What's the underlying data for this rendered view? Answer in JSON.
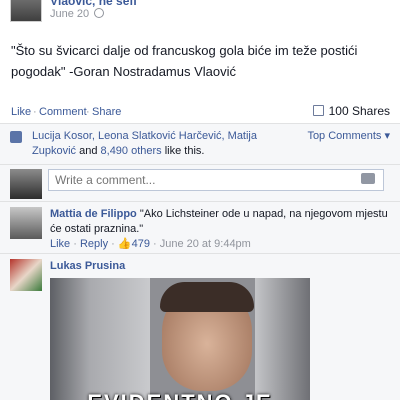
{
  "post": {
    "author": "Vlaović, ne šefi",
    "date": "June 20",
    "text": "\"Što su švicarci dalje od francuskog gola biće im teže postići pogodak\" -Goran Nostradamus Vlaović"
  },
  "actions": {
    "like": "Like",
    "comment": "Comment",
    "share": "Share",
    "sep": "·",
    "shares": "100 Shares"
  },
  "likes": {
    "names": "Lucija Kosor, Leona Slatković Harčević, Matija Zupković",
    "and": "and",
    "others": "8,490 others",
    "suffix": "like this.",
    "top_comments": "Top Comments ▾"
  },
  "composer": {
    "placeholder": "Write a comment..."
  },
  "comments": [
    {
      "author": "Mattia de Filippo",
      "text": "\"Ako Lichsteiner ode u napad, na njegovom mjestu će ostati praznina.\"",
      "like": "Like",
      "reply": "Reply",
      "likes": "479",
      "time": "June 20 at 9:44pm"
    },
    {
      "author": "Lukas Prusina",
      "image_caption": "EVIDENTNO JE"
    }
  ],
  "icons": {
    "globe": "globe-icon",
    "shares": "share-icon",
    "thumb": "like-thumb-icon",
    "camera": "camera-icon"
  },
  "colors": {
    "link": "#3b5998",
    "muted": "#90949c",
    "ufi_bg": "#f6f7f9"
  }
}
